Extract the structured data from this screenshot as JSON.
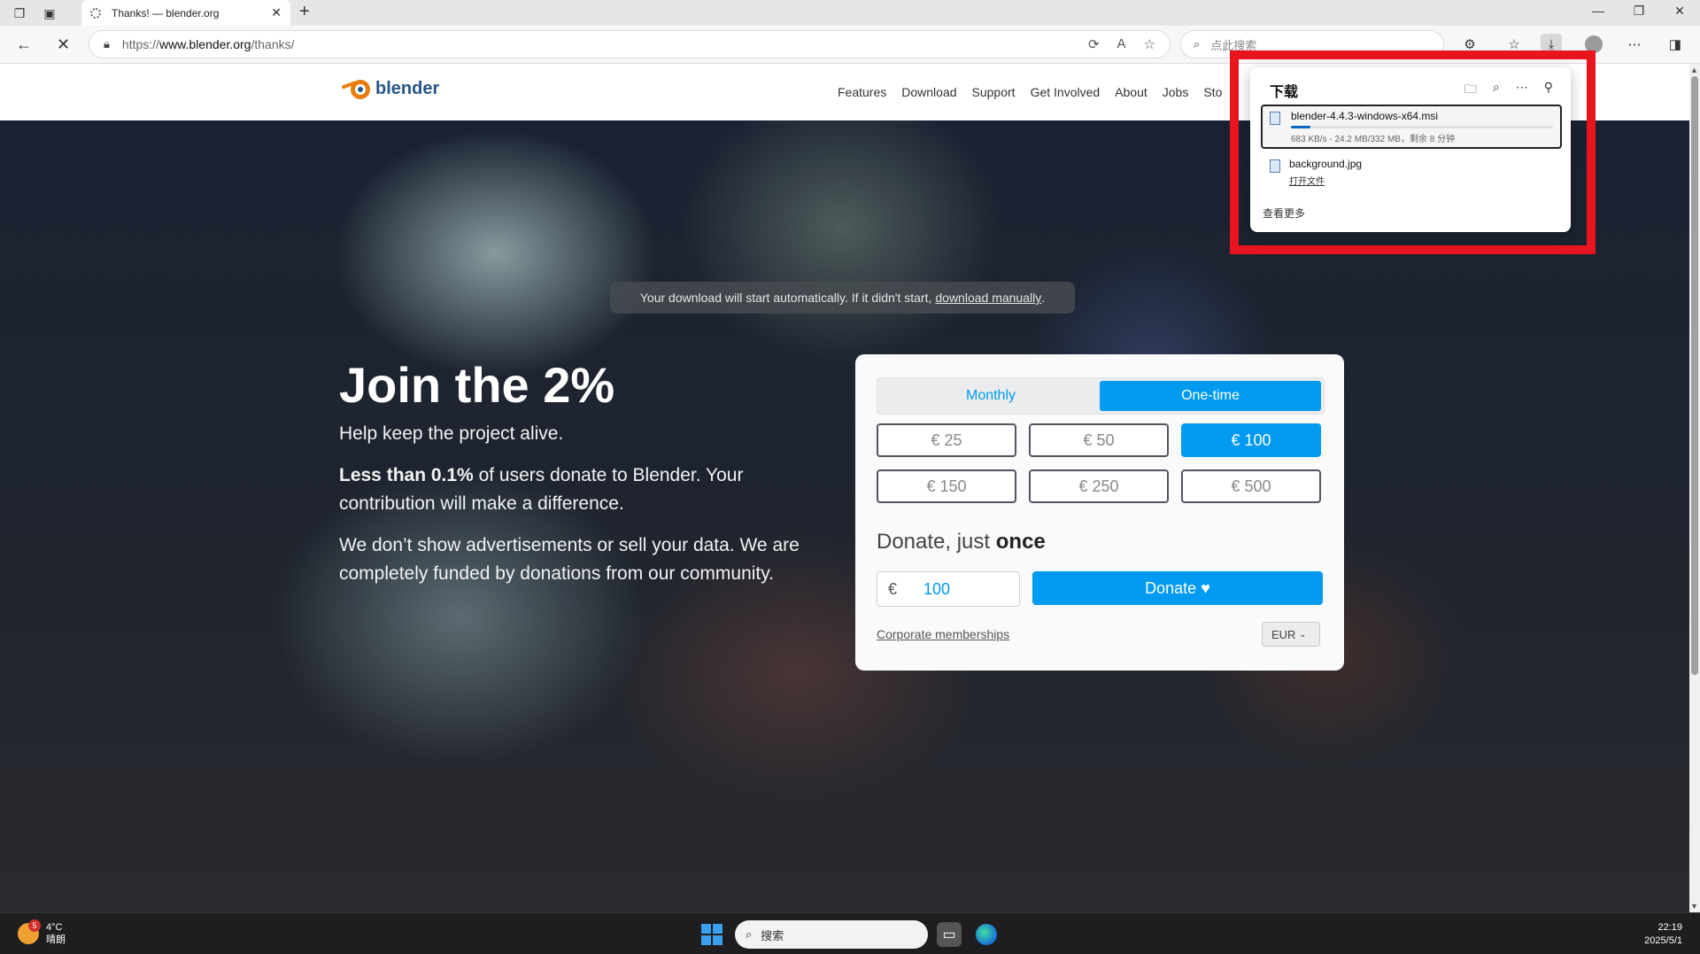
{
  "browser": {
    "tab_title": "Thanks! — blender.org",
    "url_scheme": "https://",
    "url_host": "www.blender.org",
    "url_path": "/thanks/",
    "search_placeholder": "点此搜索"
  },
  "site": {
    "logo_text": "blender",
    "nav": [
      "Features",
      "Download",
      "Support",
      "Get Involved",
      "About",
      "Jobs",
      "Sto"
    ]
  },
  "notice": {
    "text": "Your download will start automatically. If it didn't start,",
    "link": "download manually",
    "end": "."
  },
  "pitch": {
    "heading": "Join the 2%",
    "subheading": "Help keep the project alive.",
    "stat_bold": "Less than 0.1%",
    "stat_rest": " of users donate to Blender. Your contribution will make a difference.",
    "ads_text": "We don’t show advertisements or sell your data. We are completely funded by donations from our community."
  },
  "donate": {
    "frequency": [
      "Monthly",
      "One-time"
    ],
    "selected_frequency": "One-time",
    "amounts": [
      "€ 25",
      "€ 50",
      "€ 100",
      "€ 150",
      "€ 250",
      "€ 500"
    ],
    "selected_amount": "€ 100",
    "once_prefix": "Donate, just ",
    "once_bold": "once",
    "currency_symbol": "€",
    "amount_value": "100",
    "donate_button": "Donate",
    "corporate_link": "Corporate memberships",
    "currency": "EUR"
  },
  "downloads": {
    "title": "下载",
    "items": [
      {
        "name": "blender-4.4.3-windows-x64.msi",
        "meta": "683 KB/s - 24.2 MB/332 MB，剩余 8 分钟",
        "progress": 0.073
      },
      {
        "name": "background.jpg",
        "action": "打开文件"
      }
    ],
    "see_more": "查看更多"
  },
  "taskbar": {
    "weather_temp": "4°C",
    "weather_desc": "晴朗",
    "weather_badge": "5",
    "search_placeholder": "搜索",
    "time": "22:19",
    "date": "2025/5/1"
  },
  "colors": {
    "accent": "#009af0",
    "highlight": "#e8141e"
  }
}
